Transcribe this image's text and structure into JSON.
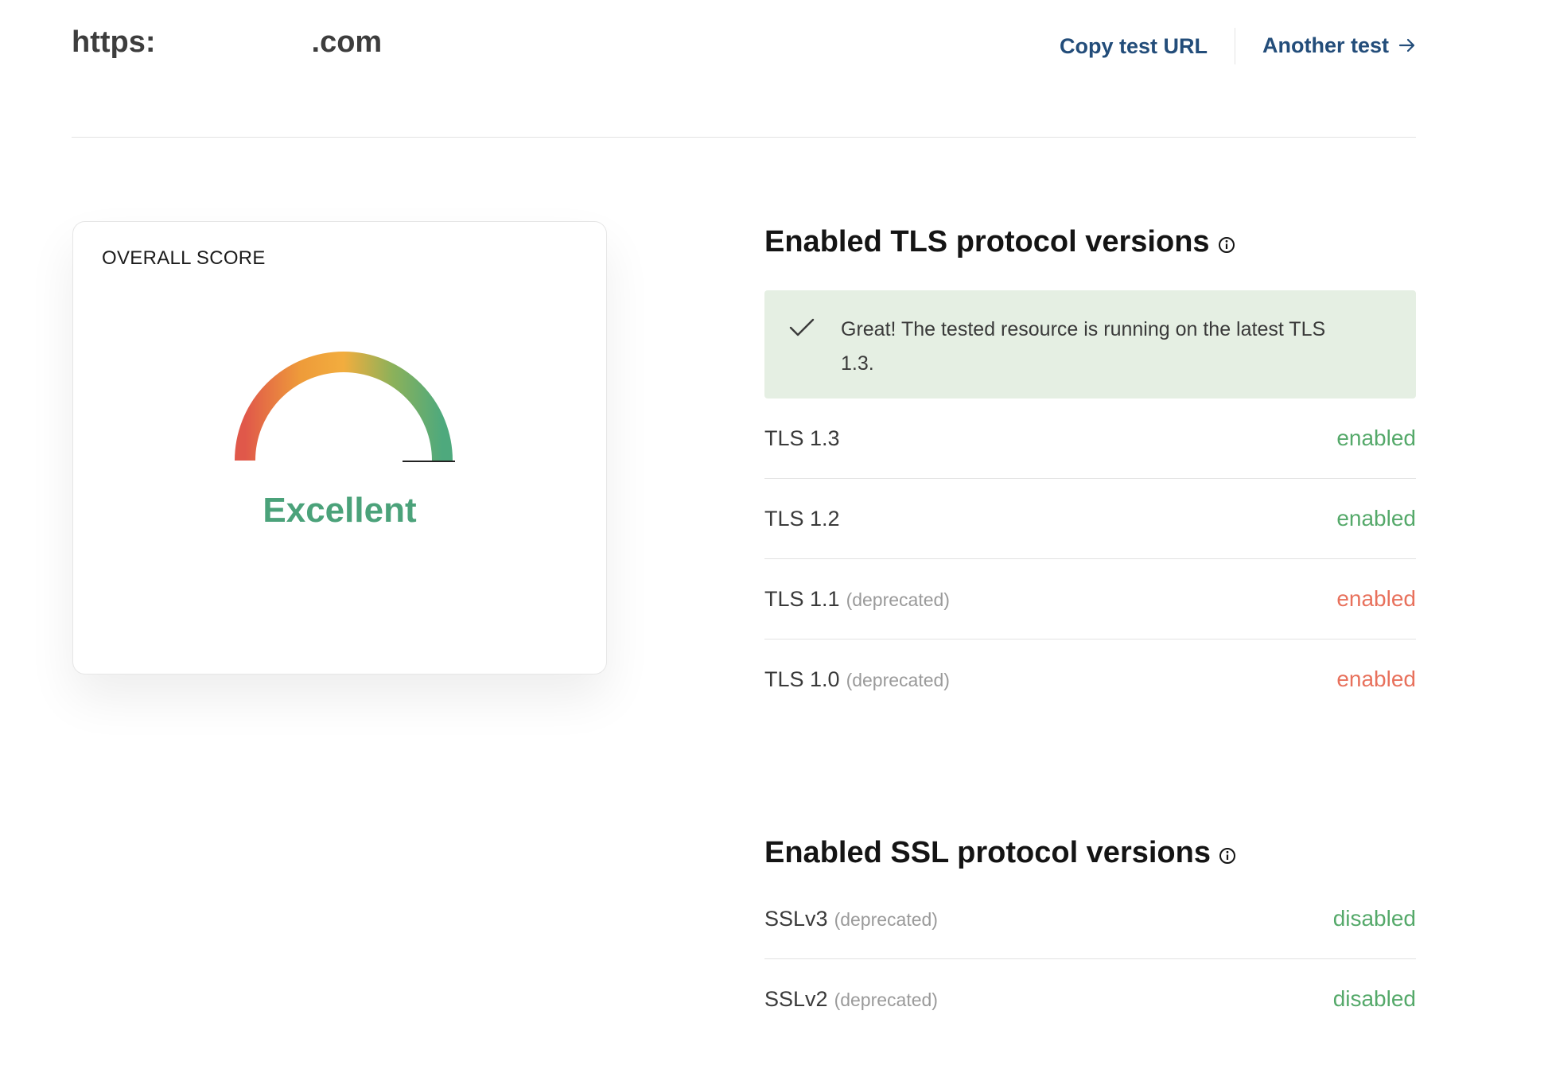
{
  "header": {
    "url_prefix": "https:",
    "url_suffix": ".com",
    "copy_link": "Copy test URL",
    "another_link": "Another test"
  },
  "score_card": {
    "title": "OVERALL SCORE",
    "rating": "Excellent",
    "gauge_colors": [
      "#e0584a",
      "#ee9b3a",
      "#f2ad3e",
      "#8bb15a",
      "#4ea97d"
    ]
  },
  "tls": {
    "title": "Enabled TLS protocol versions",
    "notice": "Great! The tested resource is running on the latest TLS 1.3.",
    "rows": [
      {
        "name": "TLS 1.3",
        "note": "",
        "status": "enabled",
        "state": "good"
      },
      {
        "name": "TLS 1.2",
        "note": "",
        "status": "enabled",
        "state": "good"
      },
      {
        "name": "TLS 1.1",
        "note": "(deprecated)",
        "status": "enabled",
        "state": "bad"
      },
      {
        "name": "TLS 1.0",
        "note": "(deprecated)",
        "status": "enabled",
        "state": "bad"
      }
    ]
  },
  "ssl": {
    "title": "Enabled SSL protocol versions",
    "rows": [
      {
        "name": "SSLv3",
        "note": "(deprecated)",
        "status": "disabled",
        "state": "good"
      },
      {
        "name": "SSLv2",
        "note": "(deprecated)",
        "status": "disabled",
        "state": "good"
      }
    ]
  },
  "colors": {
    "good": "#55a96a",
    "bad": "#e8715c",
    "link": "#234d7a",
    "notice_bg": "#e5efe3"
  }
}
